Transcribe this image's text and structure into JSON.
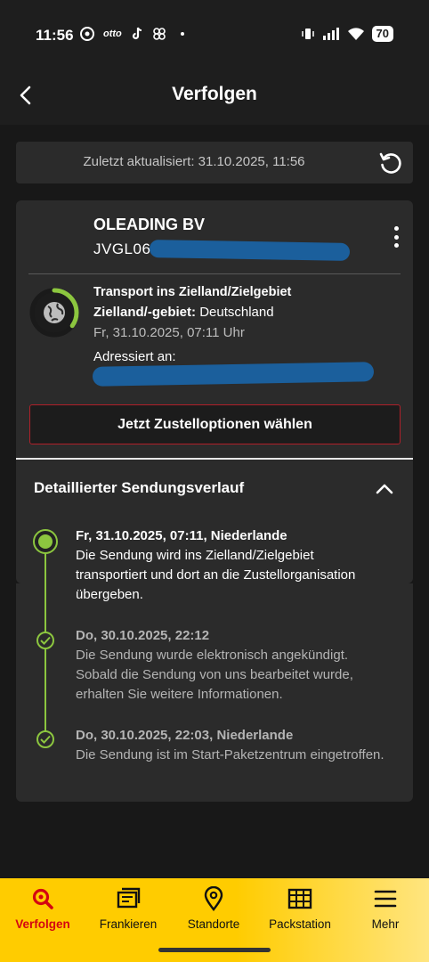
{
  "status_bar": {
    "time": "11:56",
    "battery": "70",
    "left_icons": [
      "chrome-icon",
      "otto-icon",
      "tiktok-icon",
      "pinwheel-icon",
      "dot-icon"
    ],
    "right_icons": [
      "vibrate-icon",
      "signal-icon",
      "wifi-icon",
      "battery-icon"
    ]
  },
  "header": {
    "title": "Verfolgen",
    "back_icon": "chevron-left-icon"
  },
  "refresh": {
    "text": "Zuletzt aktualisiert: 31.10.2025, 11:56",
    "icon": "refresh-icon"
  },
  "shipment": {
    "sender": "OLEADING BV",
    "tracking_prefix": "JVGL06",
    "status_title": "Transport ins Zielland/Zielgebiet",
    "destination_label": "Zielland/-gebiet:",
    "destination_value": "Deutschland",
    "date": "Fr, 31.10.2025, 07:11 Uhr",
    "addressed_label": "Adressiert an:",
    "delivery_button": "Jetzt Zustelloptionen wählen",
    "progress_fraction": 0.35,
    "colors": {
      "accent_green": "#8cc63f",
      "dhl_red": "#d40511",
      "dhl_yellow": "#ffcc00"
    }
  },
  "history": {
    "title": "Detaillierter Sendungsverlauf",
    "events": [
      {
        "title": "Fr, 31.10.2025, 07:11, Niederlande",
        "text": "Die Sendung wird ins Zielland/Zielgebiet transportiert und dort an die Zustellorganisation übergeben."
      },
      {
        "title": "Do, 30.10.2025, 22:12",
        "text": "Die Sendung wurde elektronisch angekündigt. Sobald die Sendung von uns bearbeitet wurde, erhalten Sie weitere Informationen."
      },
      {
        "title": "Do, 30.10.2025, 22:03, Niederlande",
        "text": "Die Sendung ist im Start-Paketzentrum eingetroffen."
      }
    ]
  },
  "tabbar": {
    "items": [
      {
        "label": "Verfolgen",
        "icon": "search-icon",
        "active": true
      },
      {
        "label": "Frankieren",
        "icon": "stamp-icon",
        "active": false
      },
      {
        "label": "Standorte",
        "icon": "location-pin-icon",
        "active": false
      },
      {
        "label": "Packstation",
        "icon": "packstation-icon",
        "active": false
      },
      {
        "label": "Mehr",
        "icon": "menu-icon",
        "active": false
      }
    ]
  }
}
